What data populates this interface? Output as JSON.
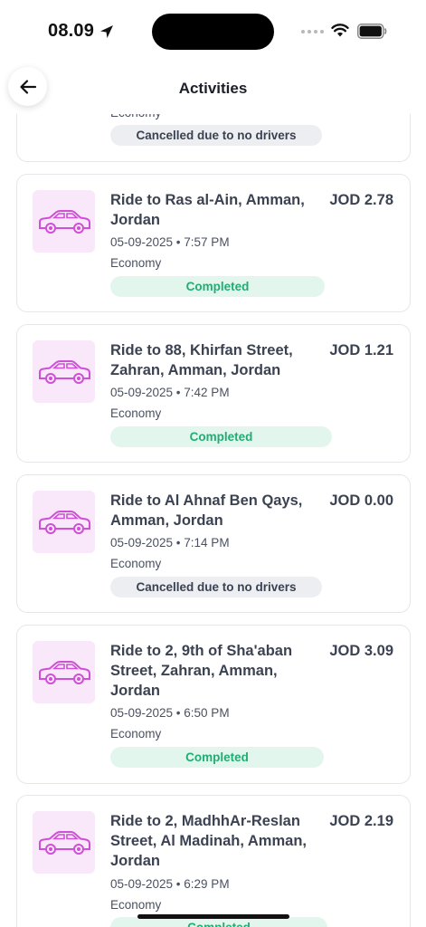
{
  "status_bar": {
    "time": "08.09",
    "icons": [
      "location-arrow-icon",
      "signal-dots-icon",
      "wifi-icon",
      "battery-icon"
    ]
  },
  "header": {
    "back_icon": "arrow-left-icon",
    "title": "Activities"
  },
  "activities": [
    {
      "title": "",
      "price": "",
      "date": "",
      "class": "Economy",
      "status": "Cancelled due to no drivers",
      "status_type": "cancelled"
    },
    {
      "title": "Ride to Ras al-Ain, Amman, Jordan",
      "price": "JOD 2.78",
      "date": "05-09-2025 • 7:57 PM",
      "class": "Economy",
      "status": "Completed",
      "status_type": "completed"
    },
    {
      "title": "Ride to 88, Khirfan Street, Zahran, Amman, Jordan",
      "price": "JOD 1.21",
      "date": "05-09-2025 • 7:42 PM",
      "class": "Economy",
      "status": "Completed",
      "status_type": "completed"
    },
    {
      "title": "Ride to Al Ahnaf Ben Qays, Amman, Jordan",
      "price": "JOD 0.00",
      "date": "05-09-2025 • 7:14 PM",
      "class": "Economy",
      "status": "Cancelled due to no drivers",
      "status_type": "cancelled"
    },
    {
      "title": "Ride to 2, 9th of Sha'aban Street, Zahran, Amman, Jordan",
      "price": "JOD 3.09",
      "date": "05-09-2025 • 6:50 PM",
      "class": "Economy",
      "status": "Completed",
      "status_type": "completed"
    },
    {
      "title": "Ride to 2, MadhhAr-Reslan Street, Al Madinah, Amman, Jordan",
      "price": "JOD 2.19",
      "date": "05-09-2025 • 6:29 PM",
      "class": "Economy",
      "status": "Completed",
      "status_type": "completed"
    }
  ],
  "colors": {
    "completed_bg": "#e3f6ee",
    "completed_text": "#1fae72",
    "cancelled_bg": "#eceef1",
    "icon_bg": "#f9e8f9",
    "car_icon": "#cf4fd6"
  }
}
